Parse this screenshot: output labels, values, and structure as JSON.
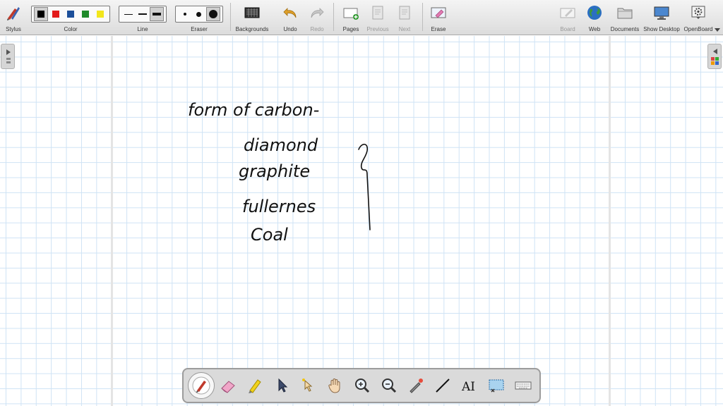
{
  "toolbar": {
    "stylus": "Stylus",
    "color": "Color",
    "line": "Line",
    "eraser": "Eraser",
    "backgrounds": "Backgrounds",
    "undo": "Undo",
    "redo": "Redo",
    "pages": "Pages",
    "previous": "Previous",
    "next": "Next",
    "erase": "Erase",
    "board": "Board",
    "web": "Web",
    "documents": "Documents",
    "show_desktop": "Show Desktop",
    "openboard": "OpenBoard"
  },
  "colors": [
    "#000000",
    "#e31b1b",
    "#1c4f9a",
    "#1f8a2a",
    "#f2e61c"
  ],
  "handwriting": {
    "heading": "form of carbon-",
    "items": [
      "diamond",
      "graphite",
      "fullernes",
      "Coal"
    ]
  },
  "stylus_tools": [
    "pen-icon",
    "eraser-icon",
    "highlighter-icon",
    "selector-icon",
    "interactor-icon",
    "hand-icon",
    "zoom-in-icon",
    "zoom-out-icon",
    "laser-pointer-icon",
    "line-icon",
    "text-icon",
    "capture-icon",
    "keyboard-icon"
  ]
}
